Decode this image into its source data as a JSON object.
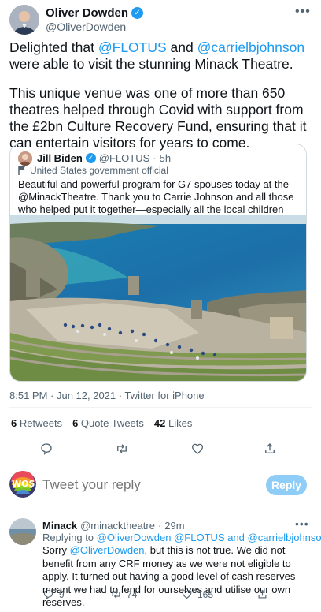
{
  "tweet": {
    "author_name": "Oliver Dowden",
    "author_handle": "@OliverDowden",
    "text_pre": "Delighted that ",
    "mention1": "@FLOTUS",
    "text_mid": " and ",
    "mention2": "@carrielbjohnson",
    "text_post": " were able to visit the stunning Minack Theatre.",
    "paragraph2": "This unique venue was one of more than 650 theatres helped through Covid with support from the £2bn Culture Recovery Fund, ensuring that it can entertain visitors for years to come.",
    "timestamp": "8:51 PM · Jun 12, 2021 · Twitter for iPhone",
    "more_icon": "more-dots-icon"
  },
  "quote": {
    "author_name": "Jill Biden",
    "author_handle": "@FLOTUS",
    "time": "5h",
    "label": "United States government official",
    "text": "Beautiful and powerful program for G7 spouses today at the @MinackTheatre. Thank you to Carrie Johnson and all those who helped put it together—especially all the local children who performed for us!"
  },
  "stats": {
    "retweets_count": "6",
    "retweets_label": "Retweets",
    "quotes_count": "6",
    "quotes_label": "Quote Tweets",
    "likes_count": "42",
    "likes_label": "Likes"
  },
  "compose": {
    "avatar_text": "WOS",
    "placeholder": "Tweet your reply",
    "reply_button": "Reply"
  },
  "reply": {
    "author_name": "Minack",
    "author_handle": "@minacktheatre",
    "time": "29m",
    "replying_prefix": "Replying to ",
    "replying_to": "@OliverDowden @FLOTUS and @carrielbjohnson",
    "text_pre": "Sorry ",
    "mention": "@OliverDowden",
    "text_post": ", but this is not true. We did not benefit from any CRF money as we were not eligible to apply. It turned out having a good level of cash reserves meant we had to fend for ourselves and utilise our own reserves.",
    "reply_count": "9",
    "retweet_count": "74",
    "like_count": "165"
  },
  "colors": {
    "accent": "#1d9bf0",
    "muted": "#536471",
    "reply_button_bg": "#8ecdf7"
  }
}
